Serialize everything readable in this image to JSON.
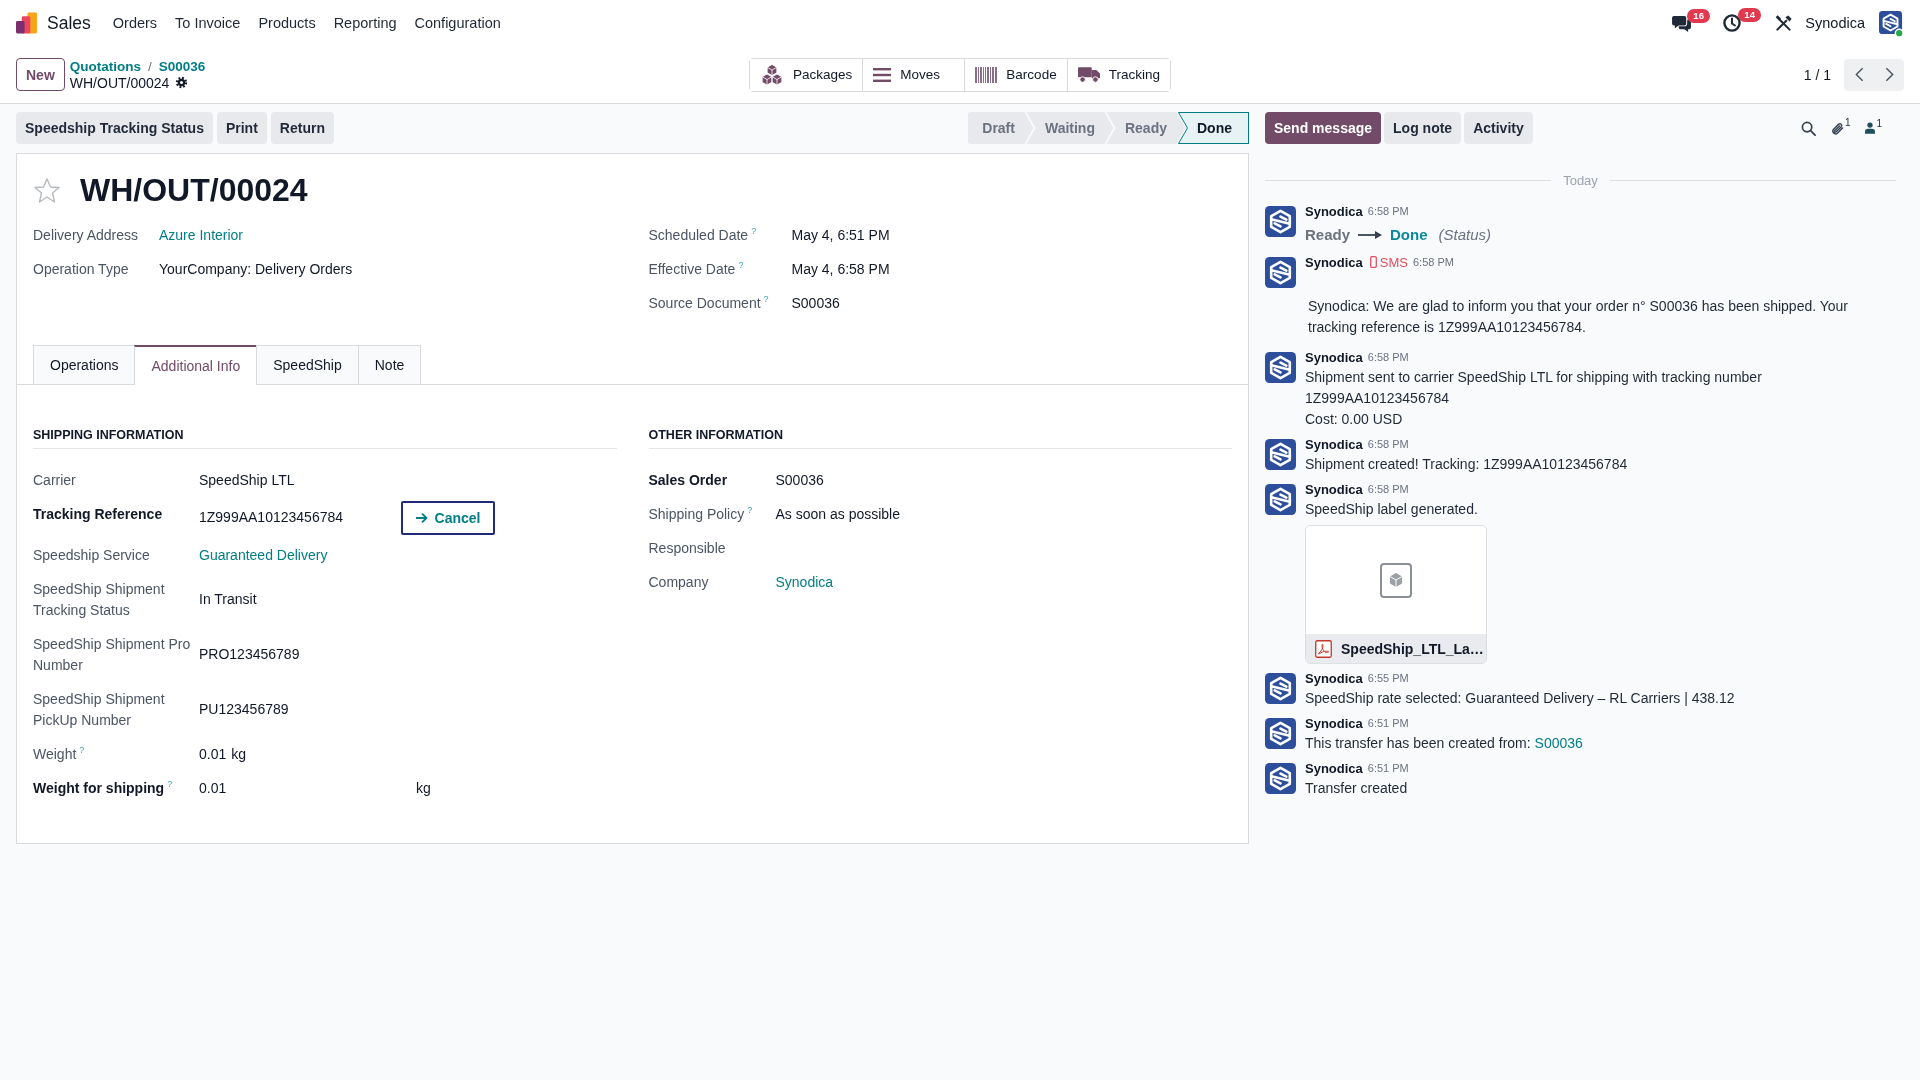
{
  "navbar": {
    "app_name": "Sales",
    "menu": [
      "Orders",
      "To Invoice",
      "Products",
      "Reporting",
      "Configuration"
    ],
    "messages_count": "16",
    "activities_count": "14",
    "user_name": "Synodica"
  },
  "control_panel": {
    "new_button": "New",
    "breadcrumbs": [
      "Quotations",
      "S00036"
    ],
    "breadcrumb_separator": "/",
    "current": "WH/OUT/00024",
    "smart_buttons": [
      {
        "kind": "packages",
        "label": "Packages"
      },
      {
        "kind": "moves",
        "label": "Moves"
      },
      {
        "kind": "barcode",
        "label": "Barcode"
      },
      {
        "kind": "tracking",
        "label": "Tracking"
      }
    ],
    "pager": "1 / 1"
  },
  "status_bar": {
    "buttons": [
      "Speedship Tracking Status",
      "Print",
      "Return"
    ],
    "stages": [
      {
        "label": "Draft",
        "selected": false
      },
      {
        "label": "Waiting",
        "selected": false
      },
      {
        "label": "Ready",
        "selected": false
      },
      {
        "label": "Done",
        "selected": true
      }
    ]
  },
  "form": {
    "starred": false,
    "title": "WH/OUT/00024",
    "main_fields_left": [
      {
        "label": "Delivery Address",
        "kind": "link",
        "value": "Azure Interior"
      },
      {
        "label": "Operation Type",
        "kind": "text",
        "value": "YourCompany: Delivery Orders"
      }
    ],
    "main_fields_right": [
      {
        "label": "Scheduled Date",
        "help": "?",
        "kind": "text",
        "value": "May 4, 6:51 PM"
      },
      {
        "label": "Effective Date",
        "help": "?",
        "kind": "text",
        "value": "May 4, 6:58 PM"
      },
      {
        "label": "Source Document",
        "help": "?",
        "kind": "text",
        "value": "S00036"
      }
    ],
    "tabs": [
      {
        "label": "Operations",
        "selected": false
      },
      {
        "label": "Additional Info",
        "selected": true
      },
      {
        "label": "SpeedShip",
        "selected": false
      },
      {
        "label": "Note",
        "selected": false
      }
    ],
    "groups": [
      {
        "title": "SHIPPING INFORMATION",
        "fields": [
          {
            "label": "Carrier",
            "required": false,
            "kind": "text",
            "value": "SpeedShip LTL"
          },
          {
            "label": "Tracking Reference",
            "required": true,
            "kind": "text",
            "value": "1Z999AA10123456784",
            "button": "Cancel"
          },
          {
            "label": "Speedship Service",
            "required": false,
            "kind": "link",
            "value": "Guaranteed Delivery"
          },
          {
            "label": "SpeedShip Shipment Tracking Status",
            "required": false,
            "kind": "text",
            "value": "In Transit"
          },
          {
            "label": "SpeedShip Shipment Pro Number",
            "required": false,
            "kind": "text",
            "value": "PRO123456789"
          },
          {
            "label": "SpeedShip Shipment PickUp Number",
            "required": false,
            "kind": "text",
            "value": "PU123456789"
          },
          {
            "label": "Weight",
            "help": "?",
            "required": false,
            "kind": "measure",
            "value": "0.01",
            "unit": "kg"
          },
          {
            "label": "Weight for shipping",
            "help": "?",
            "required": true,
            "kind": "input",
            "value": "0.01",
            "unit": "kg"
          }
        ]
      },
      {
        "title": "OTHER INFORMATION",
        "fields": [
          {
            "label": "Sales Order",
            "required": true,
            "kind": "text",
            "value": "S00036"
          },
          {
            "label": "Shipping Policy",
            "help": "?",
            "required": false,
            "kind": "text",
            "value": "As soon as possible"
          },
          {
            "label": "Responsible",
            "required": false,
            "kind": "text"
          },
          {
            "label": "Company",
            "required": false,
            "kind": "link",
            "value": "Synodica"
          }
        ]
      }
    ]
  },
  "chatter": {
    "buttons": [
      {
        "kind": "primary",
        "label": "Send message"
      },
      {
        "kind": "secondary",
        "label": "Log note"
      },
      {
        "kind": "secondary",
        "label": "Activity"
      }
    ],
    "attachments_count": "1",
    "followers_count": "1",
    "date_separator": "Today",
    "messages": [
      {
        "kind": "tracking",
        "author": "Synodica",
        "time": "6:58 PM",
        "old_value": "Ready",
        "new_value": "Done",
        "field": "(Status)"
      },
      {
        "kind": "sms",
        "author": "Synodica",
        "channel": "SMS",
        "time": "6:58 PM",
        "lines": [
          "Synodica: We are glad to inform you that your order n° S00036 has been shipped. Your tracking reference is 1Z999AA10123456784."
        ]
      },
      {
        "kind": "note",
        "author": "Synodica",
        "time": "6:58 PM",
        "lines": [
          "Shipment sent to carrier SpeedShip LTL for shipping with tracking number 1Z999AA10123456784",
          "Cost: 0.00 USD"
        ]
      },
      {
        "kind": "note",
        "author": "Synodica",
        "time": "6:58 PM",
        "lines": [
          "Shipment created! Tracking: 1Z999AA10123456784"
        ]
      },
      {
        "kind": "note",
        "author": "Synodica",
        "time": "6:58 PM",
        "lines": [
          "SpeedShip label generated."
        ],
        "attachment": "SpeedShip_LTL_La…"
      },
      {
        "kind": "note",
        "author": "Synodica",
        "time": "6:55 PM",
        "lines": [
          "SpeedShip rate selected: Guaranteed Delivery – RL Carriers | 438.12"
        ]
      },
      {
        "kind": "note",
        "author": "Synodica",
        "time": "6:51 PM",
        "lines": [
          "This transfer has been created from:"
        ],
        "link": "S00036"
      },
      {
        "kind": "note",
        "author": "Synodica",
        "time": "6:51 PM",
        "lines": [
          "Transfer created"
        ]
      }
    ]
  }
}
